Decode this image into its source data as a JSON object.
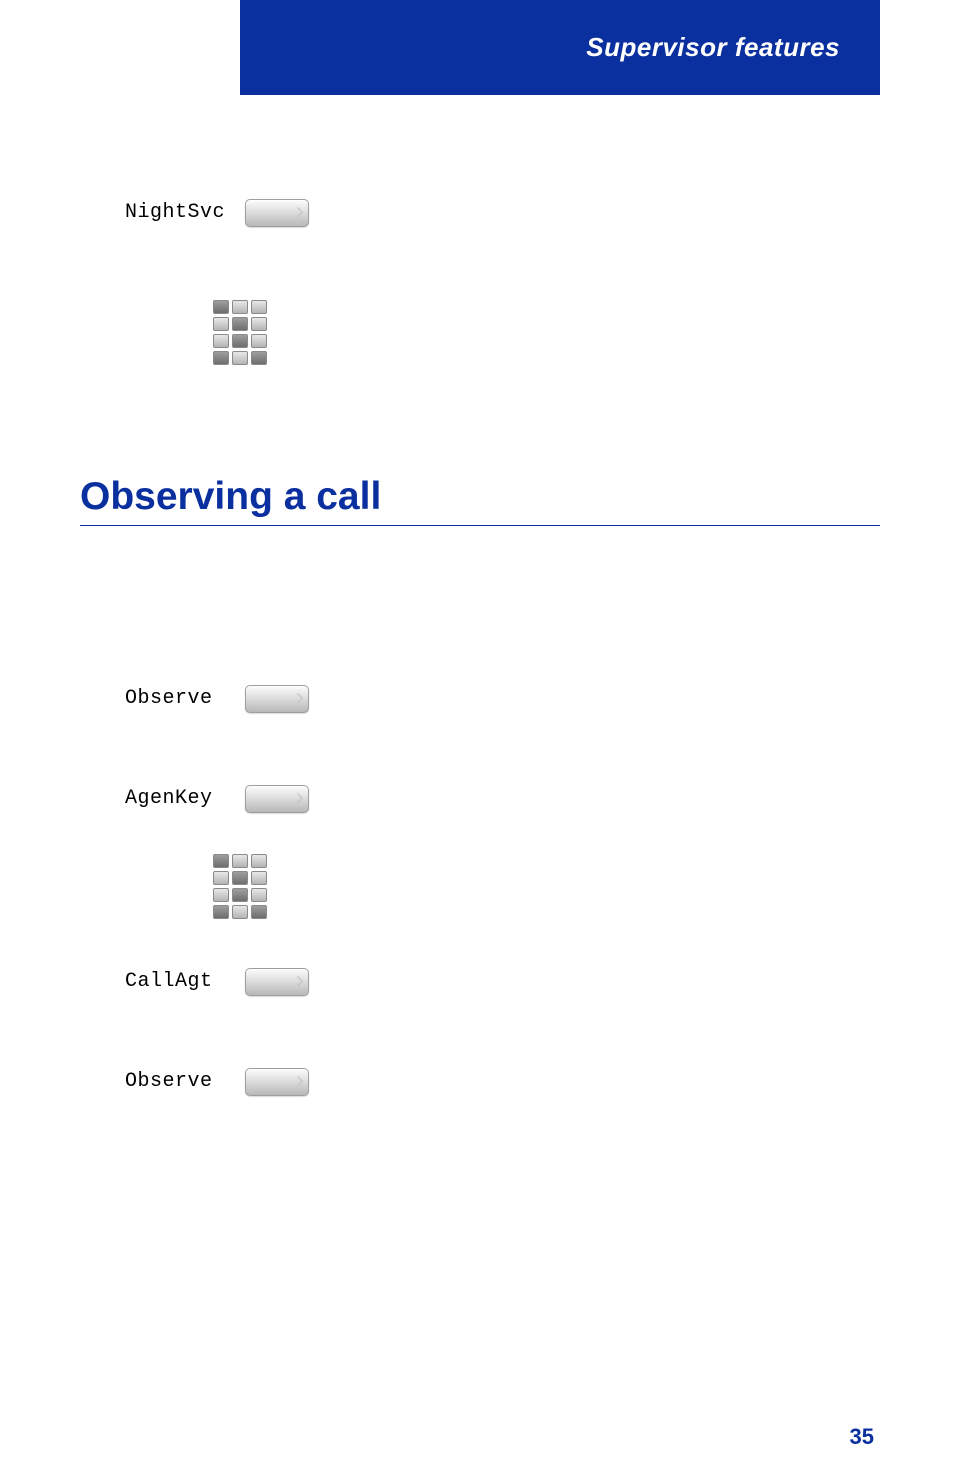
{
  "header": {
    "title": "Supervisor features"
  },
  "section1": {
    "keys": {
      "nightsvc": "NightSvc"
    }
  },
  "section_title": "Observing a call",
  "section2": {
    "keys": {
      "observe1": "Observe",
      "agenkey": "AgenKey",
      "callagt": "CallAgt",
      "observe2": "Observe"
    }
  },
  "page_number": "35"
}
